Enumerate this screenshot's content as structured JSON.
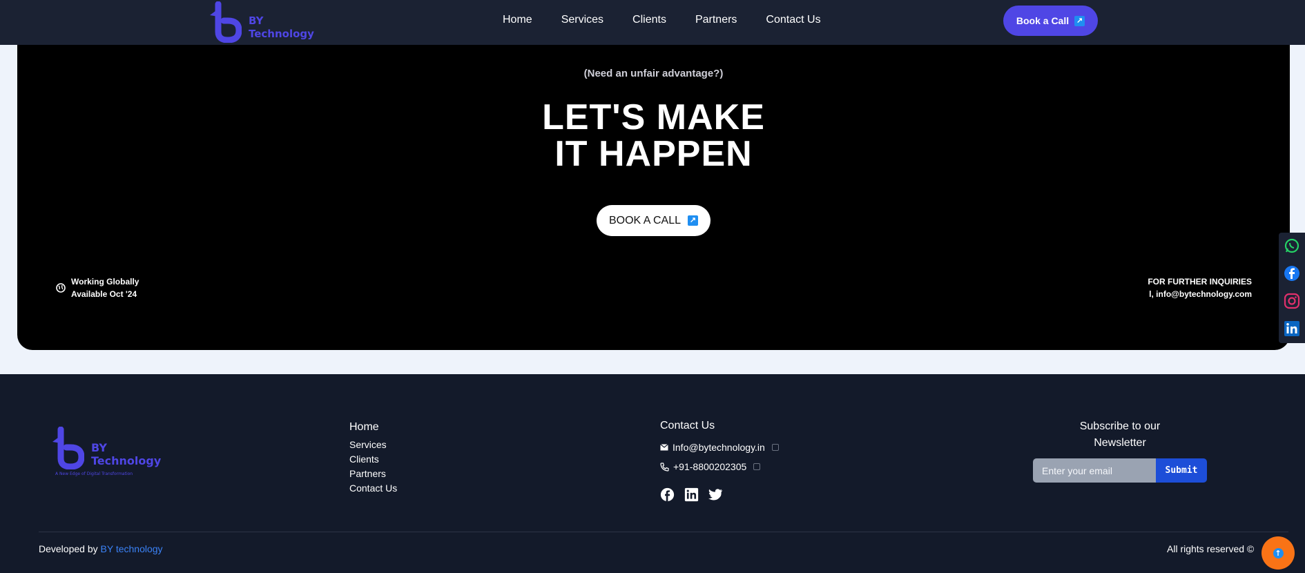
{
  "colors": {
    "brand": "#4f46e5",
    "nav_bg": "#1b2233",
    "hero_bg": "#000000",
    "footer_bg": "#131a2a",
    "scroll_top": "#f97316",
    "submit_bg": "#1d4ed8"
  },
  "navbar": {
    "logo": {
      "line1": "BY",
      "line2": "Technology"
    },
    "links": [
      "Home",
      "Services",
      "Clients",
      "Partners",
      "Contact Us"
    ],
    "cta": {
      "label": "Book a Call",
      "icon": "external-link-icon"
    }
  },
  "hero": {
    "tagline": "(Need an unfair advantage?)",
    "title_line1": "LET'S MAKE",
    "title_line2": "IT HAPPEN",
    "cta": {
      "label": "BOOK A CALL",
      "icon": "external-link-icon"
    },
    "left_info": {
      "icon": "globe-icon",
      "line1": "Working Globally",
      "line2": "Available Oct '24"
    },
    "right_info": {
      "line1": "FOR FURTHER INQUIRIES",
      "line2": "l, info@bytechnology.com"
    }
  },
  "social_sidebar": {
    "items": [
      "whatsapp-icon",
      "facebook-icon",
      "instagram-icon",
      "linkedin-icon"
    ]
  },
  "footer": {
    "logo": {
      "line1": "BY",
      "line2": "Technology",
      "slogan": "A New Edge of Digital Transformation"
    },
    "links": [
      "Home",
      "Services",
      "Clients",
      "Partners",
      "Contact Us"
    ],
    "contact": {
      "heading": "Contact Us",
      "email": "Info@bytechnology.in",
      "phone": "+91-8800202305",
      "social": [
        "facebook-icon",
        "linkedin-icon",
        "twitter-icon"
      ]
    },
    "subscribe": {
      "heading_line1": "Subscribe to our",
      "heading_line2": "Newsletter",
      "placeholder": "Enter your email",
      "submit_label": "Submit"
    },
    "developed_prefix": "Developed by ",
    "developed_brand": "BY technology",
    "rights": "All rights reserved ©"
  }
}
